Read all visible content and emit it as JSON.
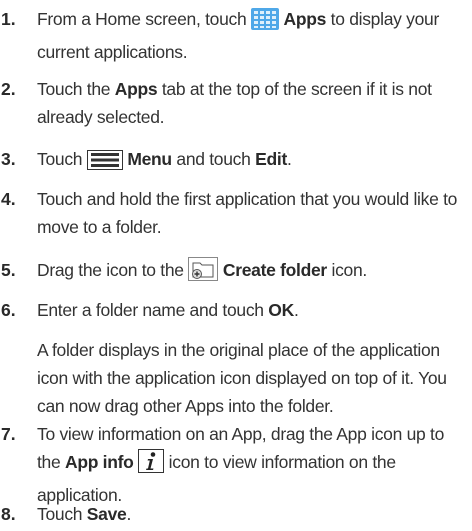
{
  "steps": [
    {
      "num": "1.",
      "parts": [
        "From a Home screen, touch ",
        "Apps",
        " to display your current applications."
      ]
    },
    {
      "num": "2.",
      "parts": [
        "Touch the ",
        "Apps",
        " tab at the top of the screen if it is not already selected."
      ]
    },
    {
      "num": "3.",
      "parts": [
        "Touch ",
        "Menu",
        " and touch ",
        "Edit",
        "."
      ]
    },
    {
      "num": "4.",
      "parts": [
        "Touch and hold the first application that you would like to move to a folder."
      ]
    },
    {
      "num": "5.",
      "parts": [
        "Drag the icon to the ",
        "Create folder",
        " icon."
      ]
    },
    {
      "num": "6.",
      "parts": [
        "Enter a folder name and touch ",
        "OK",
        "."
      ],
      "note": "A folder displays in the original place of the application icon with the application icon displayed on top of it. You can now drag other Apps into the folder."
    },
    {
      "num": "7.",
      "parts": [
        "To view information on an App, drag the App icon up to the ",
        "App info",
        " icon to view information on the application."
      ]
    },
    {
      "num": "8.",
      "parts": [
        "Touch ",
        "Save",
        "."
      ]
    }
  ],
  "icons": {
    "apps": "apps-grid-icon",
    "menu": "menu-icon",
    "folder": "create-folder-icon",
    "info": "app-info-icon"
  },
  "colors": {
    "apps_icon": "#4fa8e8",
    "text": "#333333"
  }
}
